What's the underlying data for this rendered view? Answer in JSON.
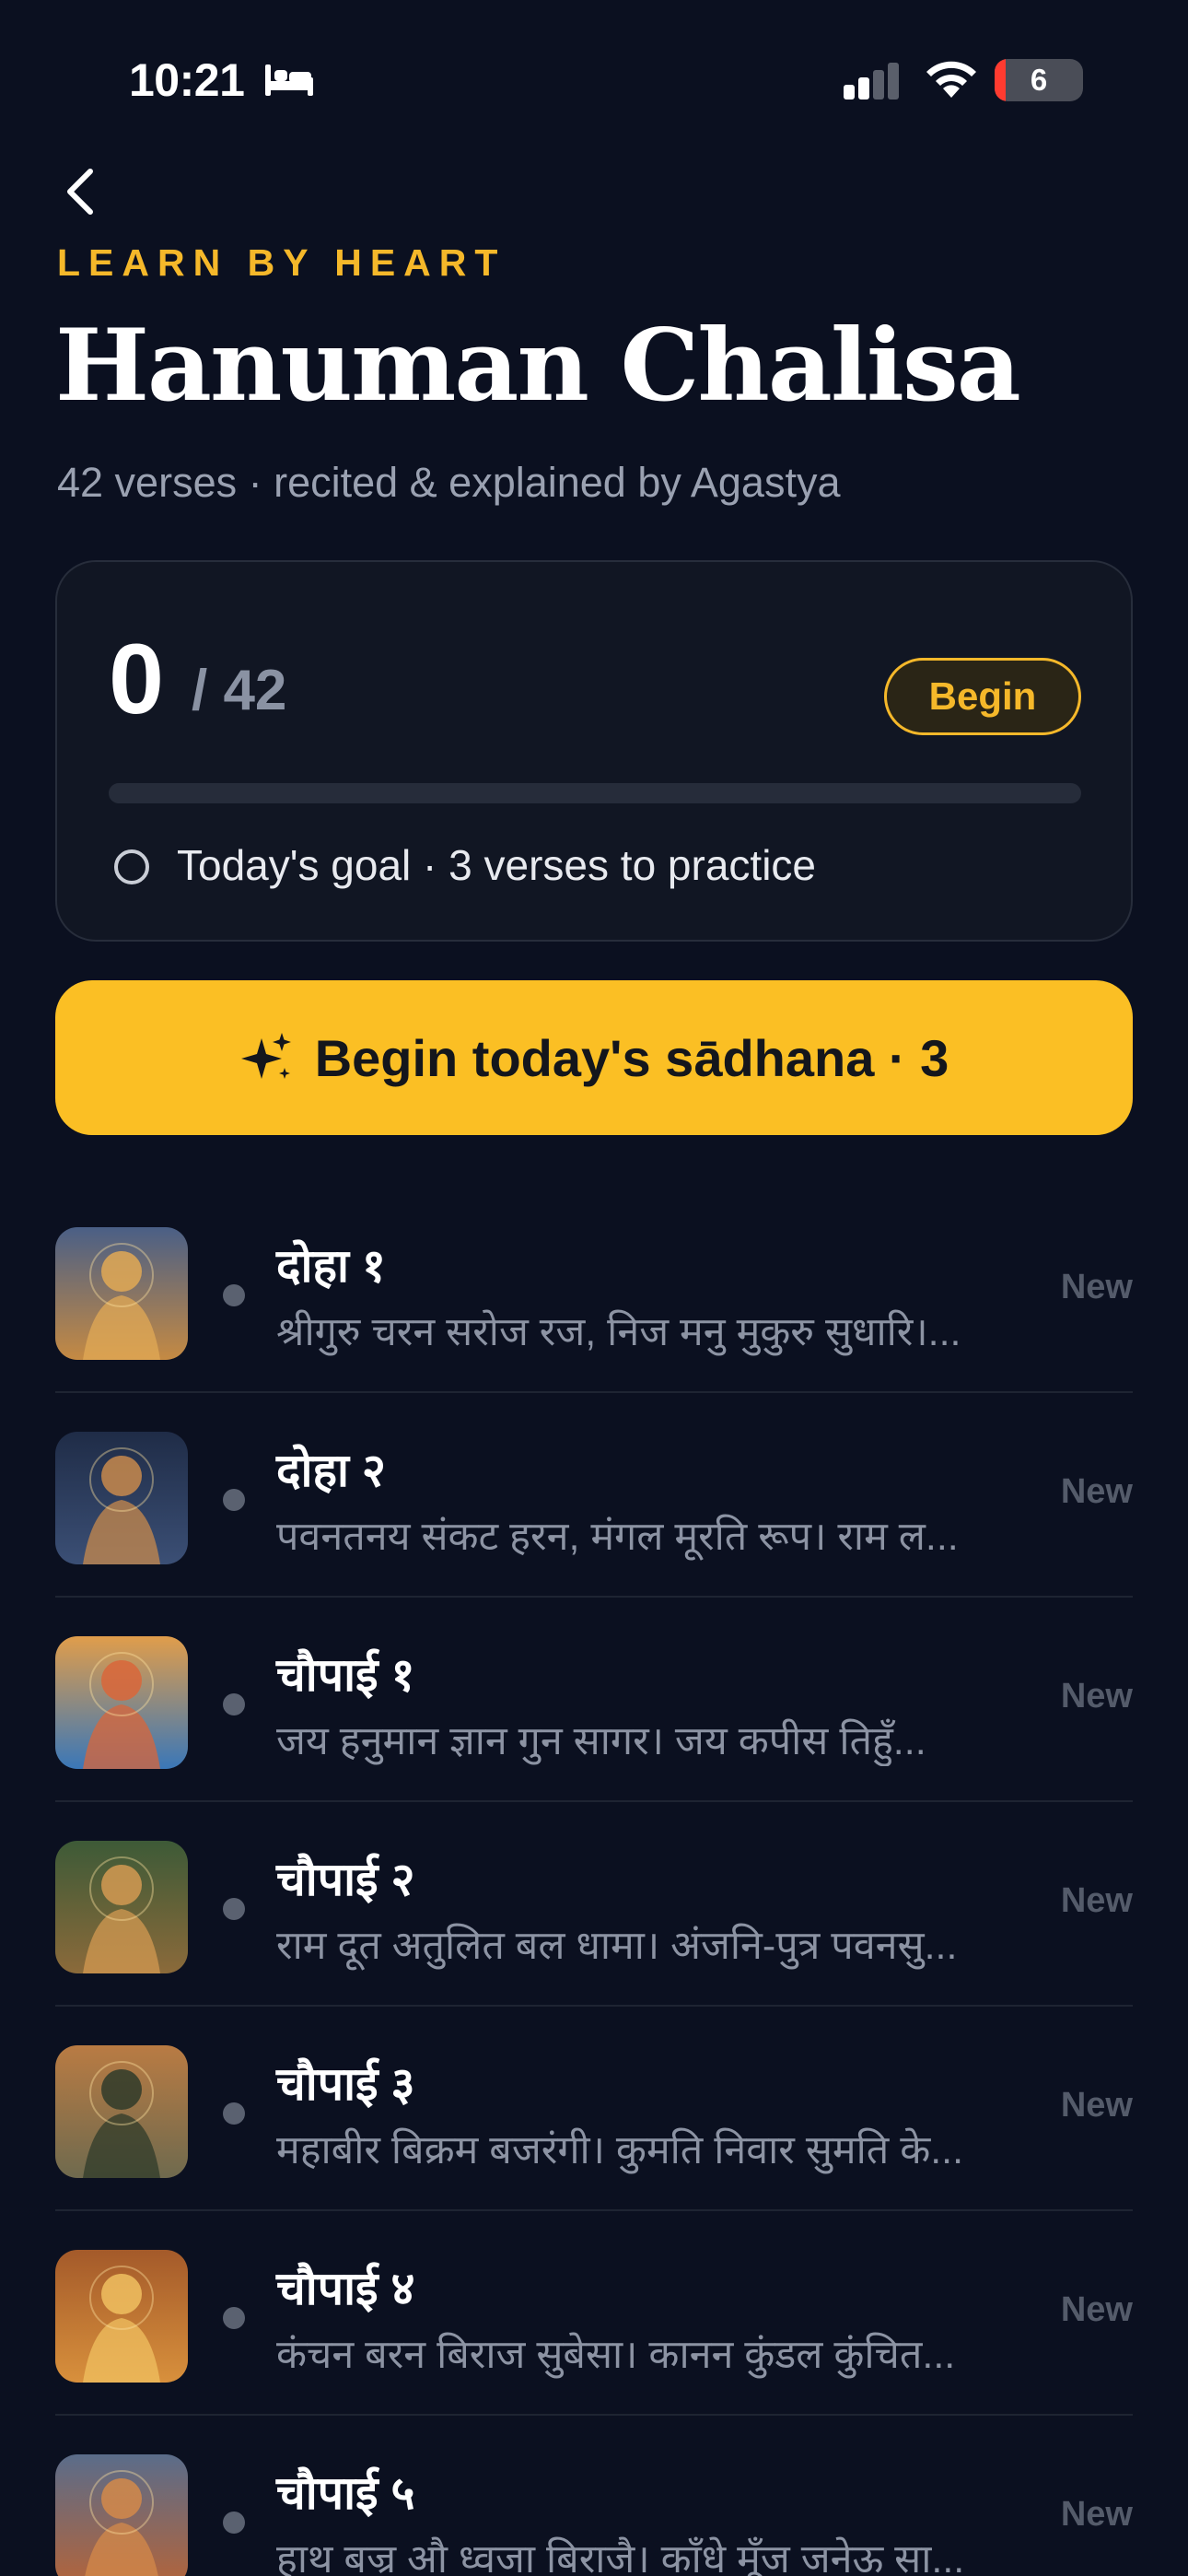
{
  "status_bar": {
    "time": "10:21",
    "battery": "6"
  },
  "header": {
    "overline": "LEARN BY HEART",
    "title": "Hanuman Chalisa",
    "subtitle": "42 verses · recited & explained by Agastya"
  },
  "progress": {
    "done": "0",
    "total": "/ 42",
    "fraction": 0,
    "begin_label": "Begin",
    "goal_text": "Today's goal · 3 verses to practice"
  },
  "cta": {
    "label": "Begin today's sādhana · 3",
    "icon": "sparkle-icon"
  },
  "verses": [
    {
      "title": "दोहा १",
      "snippet": "श्रीगुरु चरन सरोज रज, निज मनु मुकुरु सुधारि।...",
      "status": "New",
      "palette": [
        "#c58a43",
        "#4a5f86",
        "#e2a955"
      ]
    },
    {
      "title": "दोहा २",
      "snippet": "पवनतनय संकट हरन, मंगल मूरति रूप। राम ल...",
      "status": "New",
      "palette": [
        "#3b4f75",
        "#1f2c47",
        "#c88a4c"
      ]
    },
    {
      "title": "चौपाई १",
      "snippet": "जय हनुमान ज्ञान गुन सागर। जय कपीस तिहुँ...",
      "status": "New",
      "palette": [
        "#3a77b8",
        "#e09d4b",
        "#d9663a"
      ]
    },
    {
      "title": "चौपाई २",
      "snippet": "राम दूत अतुलित बल धामा। अंजनि-पुत्र पवनसु...",
      "status": "New",
      "palette": [
        "#8b6a3a",
        "#3d5a37",
        "#d39a52"
      ]
    },
    {
      "title": "चौपाई ३",
      "snippet": "महाबीर बिक्रम बजरंगी। कुमति निवार सुमति के...",
      "status": "New",
      "palette": [
        "#6f6a4e",
        "#b97b43",
        "#2f3b2a"
      ]
    },
    {
      "title": "चौपाई ४",
      "snippet": "कंचन बरन बिराज सुबेसा। कानन कुंडल कुंचित...",
      "status": "New",
      "palette": [
        "#d8903c",
        "#a45a2a",
        "#f0c060"
      ]
    },
    {
      "title": "चौपाई ५",
      "snippet": "हाथ बज्र औ ध्वजा बिराजै। काँधे मूँज जनेऊ सा...",
      "status": "New",
      "palette": [
        "#b4643a",
        "#5a6c8a",
        "#d48a4a"
      ]
    }
  ]
}
